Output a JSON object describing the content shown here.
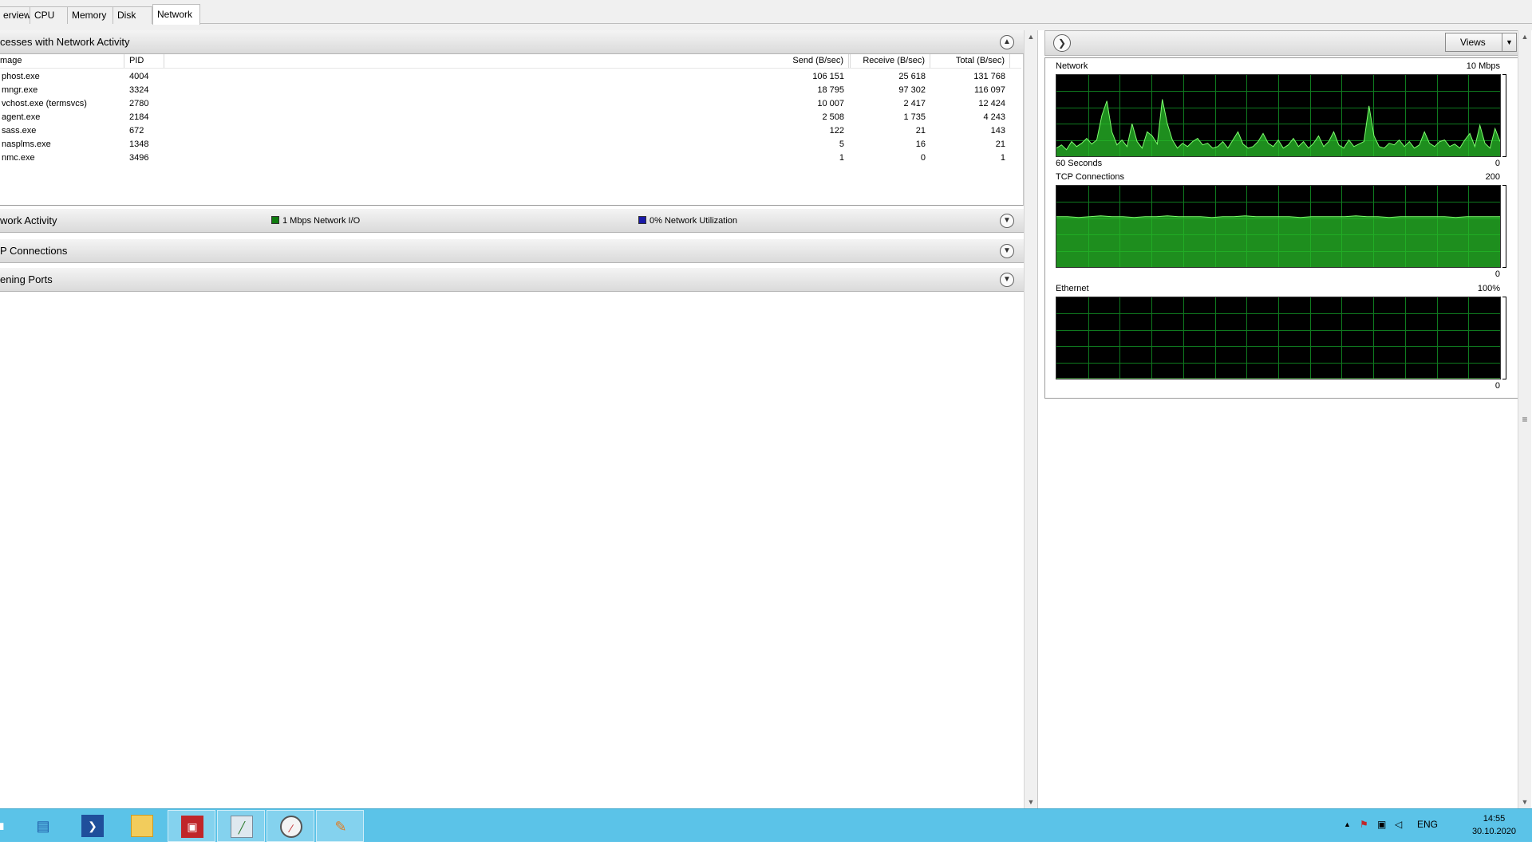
{
  "tabs": [
    {
      "label": "erview"
    },
    {
      "label": "CPU"
    },
    {
      "label": "Memory"
    },
    {
      "label": "Disk"
    },
    {
      "label": "Network"
    }
  ],
  "processes_section": {
    "title": "cesses with Network Activity",
    "columns": [
      "mage",
      "PID",
      "Send (B/sec)",
      "Receive (B/sec)",
      "Total (B/sec)"
    ],
    "rows": [
      {
        "image": "phost.exe",
        "pid": "4004",
        "send": "106 151",
        "receive": "25 618",
        "total": "131 768"
      },
      {
        "image": "mngr.exe",
        "pid": "3324",
        "send": "18 795",
        "receive": "97 302",
        "total": "116 097"
      },
      {
        "image": "vchost.exe (termsvcs)",
        "pid": "2780",
        "send": "10 007",
        "receive": "2 417",
        "total": "12 424"
      },
      {
        "image": "agent.exe",
        "pid": "2184",
        "send": "2 508",
        "receive": "1 735",
        "total": "4 243"
      },
      {
        "image": "sass.exe",
        "pid": "672",
        "send": "122",
        "receive": "21",
        "total": "143"
      },
      {
        "image": "nasplms.exe",
        "pid": "1348",
        "send": "5",
        "receive": "16",
        "total": "21"
      },
      {
        "image": "nmc.exe",
        "pid": "3496",
        "send": "1",
        "receive": "0",
        "total": "1"
      }
    ]
  },
  "network_activity": {
    "title": "work Activity",
    "legend": [
      {
        "label": "1 Mbps Network I/O",
        "color": "#107c10"
      },
      {
        "label": "0% Network Utilization",
        "color": "#1a1aa8"
      }
    ]
  },
  "tcp_section": {
    "title": "P Connections"
  },
  "ports_section": {
    "title": "ening Ports"
  },
  "right_panel": {
    "views_label": "Views",
    "graphs": [
      {
        "title": "Network",
        "max": "10 Mbps",
        "footer_left": "60 Seconds",
        "footer_right": "0",
        "values": [
          0.1,
          0.14,
          0.08,
          0.18,
          0.12,
          0.16,
          0.22,
          0.15,
          0.2,
          0.5,
          0.68,
          0.3,
          0.14,
          0.2,
          0.12,
          0.4,
          0.18,
          0.1,
          0.3,
          0.25,
          0.15,
          0.7,
          0.4,
          0.2,
          0.1,
          0.16,
          0.12,
          0.18,
          0.22,
          0.14,
          0.16,
          0.1,
          0.12,
          0.18,
          0.1,
          0.2,
          0.3,
          0.15,
          0.1,
          0.12,
          0.18,
          0.28,
          0.16,
          0.12,
          0.2,
          0.1,
          0.14,
          0.22,
          0.12,
          0.18,
          0.1,
          0.16,
          0.25,
          0.12,
          0.18,
          0.3,
          0.14,
          0.1,
          0.2,
          0.12,
          0.15,
          0.18,
          0.62,
          0.25,
          0.12,
          0.1,
          0.16,
          0.14,
          0.2,
          0.12,
          0.18,
          0.1,
          0.14,
          0.3,
          0.16,
          0.12,
          0.18,
          0.2,
          0.12,
          0.15,
          0.1,
          0.2,
          0.28,
          0.12,
          0.38,
          0.16,
          0.1,
          0.34,
          0.18
        ]
      },
      {
        "title": "TCP Connections",
        "max": "200",
        "footer_right": "0",
        "values": [
          0.62,
          0.62,
          0.61,
          0.62,
          0.63,
          0.62,
          0.62,
          0.61,
          0.62,
          0.62,
          0.63,
          0.62,
          0.62,
          0.62,
          0.61,
          0.62,
          0.62,
          0.63,
          0.62,
          0.62,
          0.62,
          0.62,
          0.61,
          0.62,
          0.62,
          0.62,
          0.62,
          0.63,
          0.62,
          0.62,
          0.61,
          0.62,
          0.62,
          0.62,
          0.62,
          0.62,
          0.61,
          0.62,
          0.62,
          0.62,
          0.62
        ]
      },
      {
        "title": "Ethernet",
        "max": "100%",
        "footer_right": "0",
        "values": [
          0,
          0,
          0,
          0,
          0,
          0,
          0,
          0,
          0,
          0,
          0
        ]
      }
    ]
  },
  "taskbar": {
    "apps": [
      {
        "icon": "server-manager-icon"
      },
      {
        "icon": "powershell-icon"
      },
      {
        "icon": "file-explorer-icon"
      },
      {
        "icon": "toolbox-icon"
      },
      {
        "icon": "performance-monitor-icon"
      },
      {
        "icon": "resource-monitor-icon"
      },
      {
        "icon": "paint-icon"
      }
    ],
    "language": "ENG",
    "time": "14:55",
    "date": "30.10.2020"
  }
}
